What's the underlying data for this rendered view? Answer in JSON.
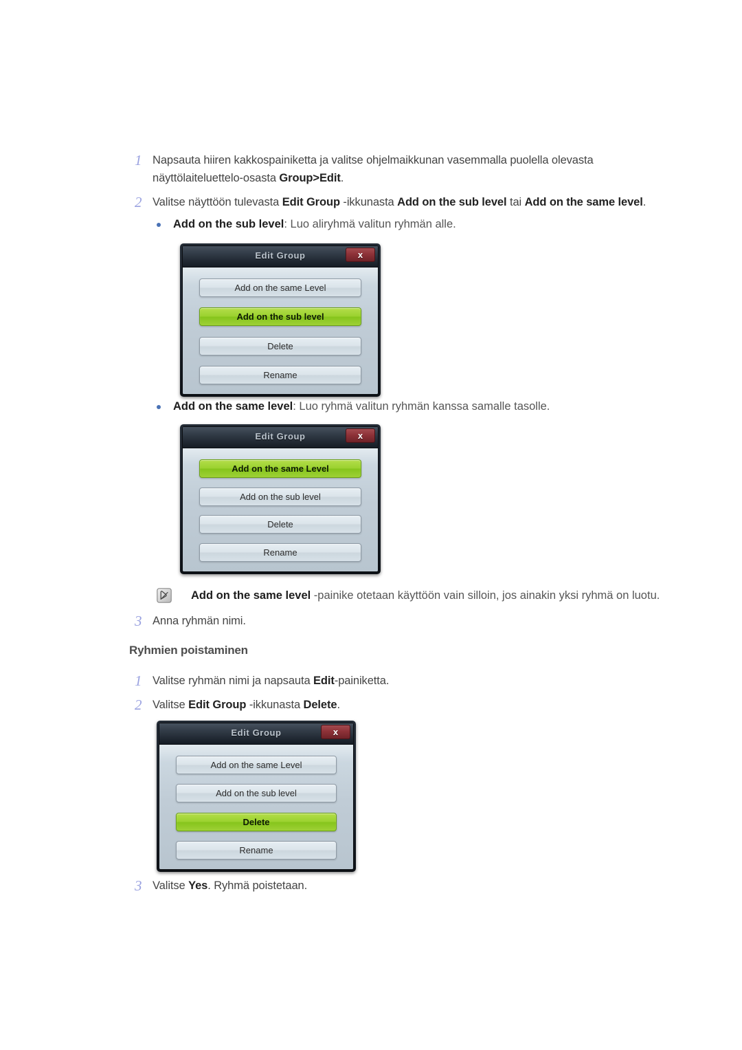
{
  "document": {
    "language": "fi",
    "accent_number_color": "#9aa2e0",
    "bullet_color": "#4a72b5",
    "selected_button_color": "#9bd22f",
    "dialog_title_color": "#b9c2cb",
    "close_button_color": "#8e3238"
  },
  "steps_top": [
    {
      "number": "1",
      "segments": [
        {
          "text": "Napsauta hiiren kakkospainiketta ja valitse ohjelmaikkunan vasemmalla puolella olevasta ",
          "bold": false
        },
        {
          "text": "näyttölaiteluettelo-osasta ",
          "bold": false,
          "newline_before": true
        },
        {
          "text": "Group>Edit",
          "bold": true
        },
        {
          "text": ".",
          "bold": false
        }
      ],
      "line1": "Napsauta hiiren kakkospainiketta ja valitse ohjelmaikkunan vasemmalla puolella olevasta",
      "line2_prefix": "näyttölaiteluettelo-osasta ",
      "line2_bold": "Group>Edit",
      "line2_suffix": "."
    },
    {
      "number": "2",
      "prefix": "Valitse näyttöön tulevasta ",
      "bold1": "Edit Group",
      "mid1": " -ikkunasta ",
      "bold2": "Add on the sub level",
      "mid2": " tai ",
      "bold3": "Add on the same level",
      "suffix": "."
    }
  ],
  "bullets": [
    {
      "bold": "Add on the sub level",
      "rest": ": Luo aliryhmä valitun ryhmän alle."
    },
    {
      "bold": "Add on the same level",
      "rest": ": Luo ryhmä valitun ryhmän kanssa samalle tasolle."
    }
  ],
  "note": {
    "icon": "note-pencil-icon",
    "bold": "Add on the same level",
    "rest": " -painike otetaan käyttöön vain silloin, jos ainakin yksi ryhmä on luotu."
  },
  "step3_top": {
    "number": "3",
    "text": "Anna ryhmän nimi."
  },
  "section_heading": "Ryhmien poistaminen",
  "steps_bottom": [
    {
      "number": "1",
      "prefix": "Valitse ryhmän nimi ja napsauta ",
      "bold1": "Edit",
      "suffix": "-painiketta."
    },
    {
      "number": "2",
      "prefix": "Valitse ",
      "bold1": "Edit Group",
      "mid1": " -ikkunasta ",
      "bold2": "Delete",
      "suffix": "."
    },
    {
      "number": "3",
      "prefix": "Valitse ",
      "bold1": "Yes",
      "suffix": ". Ryhmä poistetaan."
    }
  ],
  "dialogs": [
    {
      "id": "dialog-sub-level",
      "title": "Edit Group",
      "close_label": "x",
      "buttons": [
        {
          "label": "Add on the same Level",
          "selected": false
        },
        {
          "label": "Add on the sub level",
          "selected": true
        },
        {
          "label": "Delete",
          "selected": false
        },
        {
          "label": "Rename",
          "selected": false
        }
      ]
    },
    {
      "id": "dialog-same-level",
      "title": "Edit Group",
      "close_label": "x",
      "buttons": [
        {
          "label": "Add on the same Level",
          "selected": true
        },
        {
          "label": "Add on the sub level",
          "selected": false
        },
        {
          "label": "Delete",
          "selected": false
        },
        {
          "label": "Rename",
          "selected": false
        }
      ]
    },
    {
      "id": "dialog-delete",
      "title": "Edit Group",
      "close_label": "x",
      "buttons": [
        {
          "label": "Add on the same Level",
          "selected": false
        },
        {
          "label": "Add on the sub level",
          "selected": false
        },
        {
          "label": "Delete",
          "selected": true
        },
        {
          "label": "Rename",
          "selected": false
        }
      ]
    }
  ]
}
